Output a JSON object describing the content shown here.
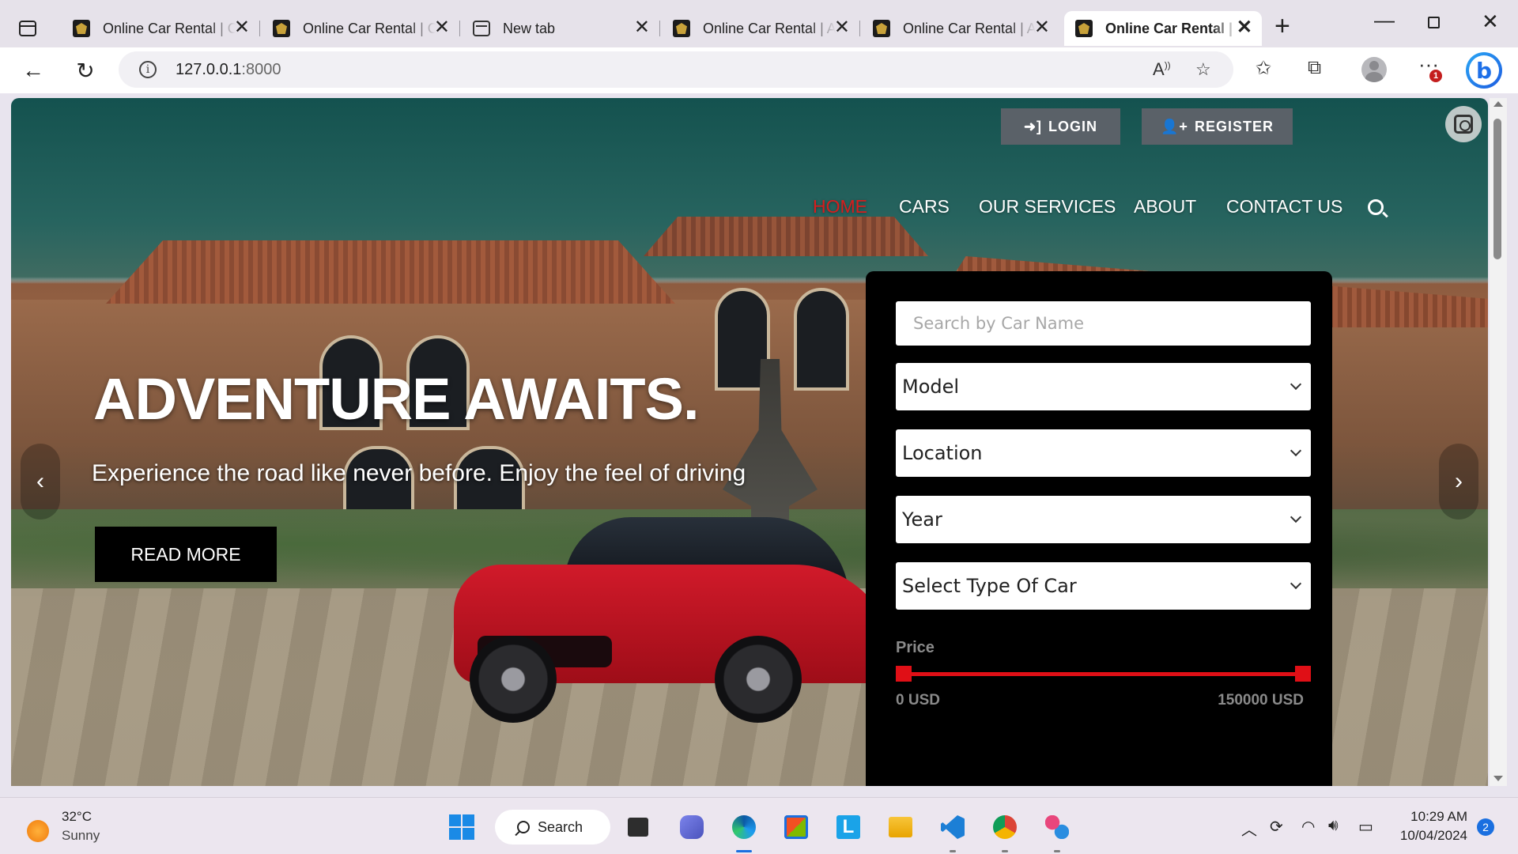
{
  "browser": {
    "tabs": [
      {
        "title": "Online Car Rental | Car Listing",
        "kind": "site",
        "active": false
      },
      {
        "title": "Online Car Rental | Car Details",
        "kind": "site",
        "active": false
      },
      {
        "title": "New tab",
        "kind": "newtab",
        "active": false
      },
      {
        "title": "Online Car Rental | About",
        "kind": "site",
        "active": false
      },
      {
        "title": "Online Car Rental | About",
        "kind": "site",
        "active": false
      },
      {
        "title": "Online Car Rental | Home",
        "kind": "site",
        "active": true
      }
    ],
    "url_host": "127.0.0.1",
    "url_port": ":8000",
    "menu_badge": "1"
  },
  "site": {
    "login_label": "LOGIN",
    "register_label": "REGISTER",
    "nav": [
      {
        "label": "HOME",
        "active": true
      },
      {
        "label": "CARS",
        "active": false
      },
      {
        "label": "OUR SERVICES",
        "active": false
      },
      {
        "label": "ABOUT",
        "active": false
      },
      {
        "label": "CONTACT US",
        "active": false
      }
    ],
    "hero": {
      "title": "ADVENTURE AWAITS.",
      "subtitle": "Experience the road like never before. Enjoy the feel of driving",
      "cta_label": "READ MORE"
    },
    "search_panel": {
      "name_placeholder": "Search by Car Name",
      "model_selected": "Model",
      "location_selected": "Location",
      "year_selected": "Year",
      "type_selected": "Select Type Of Car",
      "price_label": "Price",
      "price_min": "0 USD",
      "price_max": "150000 USD",
      "price_range_fraction": [
        0,
        1
      ]
    }
  },
  "taskbar": {
    "temperature": "32°C",
    "condition": "Sunny",
    "search_label": "Search",
    "time": "10:29 AM",
    "date": "10/04/2024",
    "notification_count": "2"
  },
  "colors": {
    "accent_red": "#e00f16",
    "nav_active": "#d81d1d",
    "auth_button": "#5a6168",
    "panel_bg": "#000000"
  }
}
